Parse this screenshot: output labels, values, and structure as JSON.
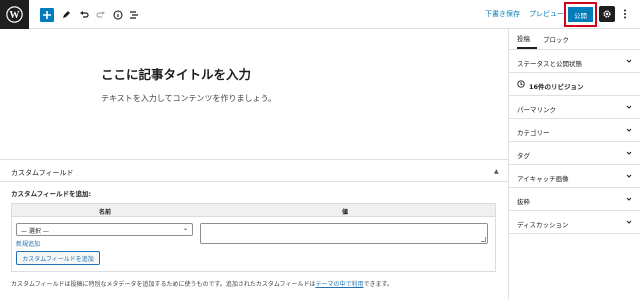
{
  "toolbar": {
    "save_draft_label": "下書き保存",
    "preview_label": "プレビュー",
    "publish_label": "公開",
    "icons": [
      "wordpress-logo",
      "add-block-icon",
      "pencil-icon",
      "undo-icon",
      "redo-icon",
      "info-icon",
      "list-view-icon",
      "gear-icon",
      "more-vertical-icon"
    ],
    "colors": {
      "accent": "#007cba",
      "highlight_border": "#d0021b",
      "dark": "#1e1e1e"
    }
  },
  "editor": {
    "title_placeholder": "ここに記事タイトルを入力",
    "body_placeholder": "テキストを入力してコンテンツを作りましょう。"
  },
  "custom_fields": {
    "header": "カスタムフィールド",
    "add_label": "カスタムフィールドを追加:",
    "col_name": "名前",
    "col_value": "値",
    "select_value": "— 選択 —",
    "new_link": "新規追加",
    "add_button": "カスタムフィールドを追加",
    "note_prefix": "カスタムフィールドは投稿に特別なメタデータを追加するために使うものです。追加されたカスタムフィールドは",
    "note_link": "テーマの中で利用",
    "note_suffix": "できます。"
  },
  "sidebar": {
    "tabs": [
      "投稿",
      "ブロック"
    ],
    "panels": {
      "status": "ステータスと公開状態",
      "revisions": "16件のリビジョン",
      "permalink": "パーマリンク",
      "category": "カテゴリー",
      "tags": "タグ",
      "featured_image": "アイキャッチ画像",
      "excerpt": "抜粋",
      "discussion": "ディスカッション"
    }
  }
}
